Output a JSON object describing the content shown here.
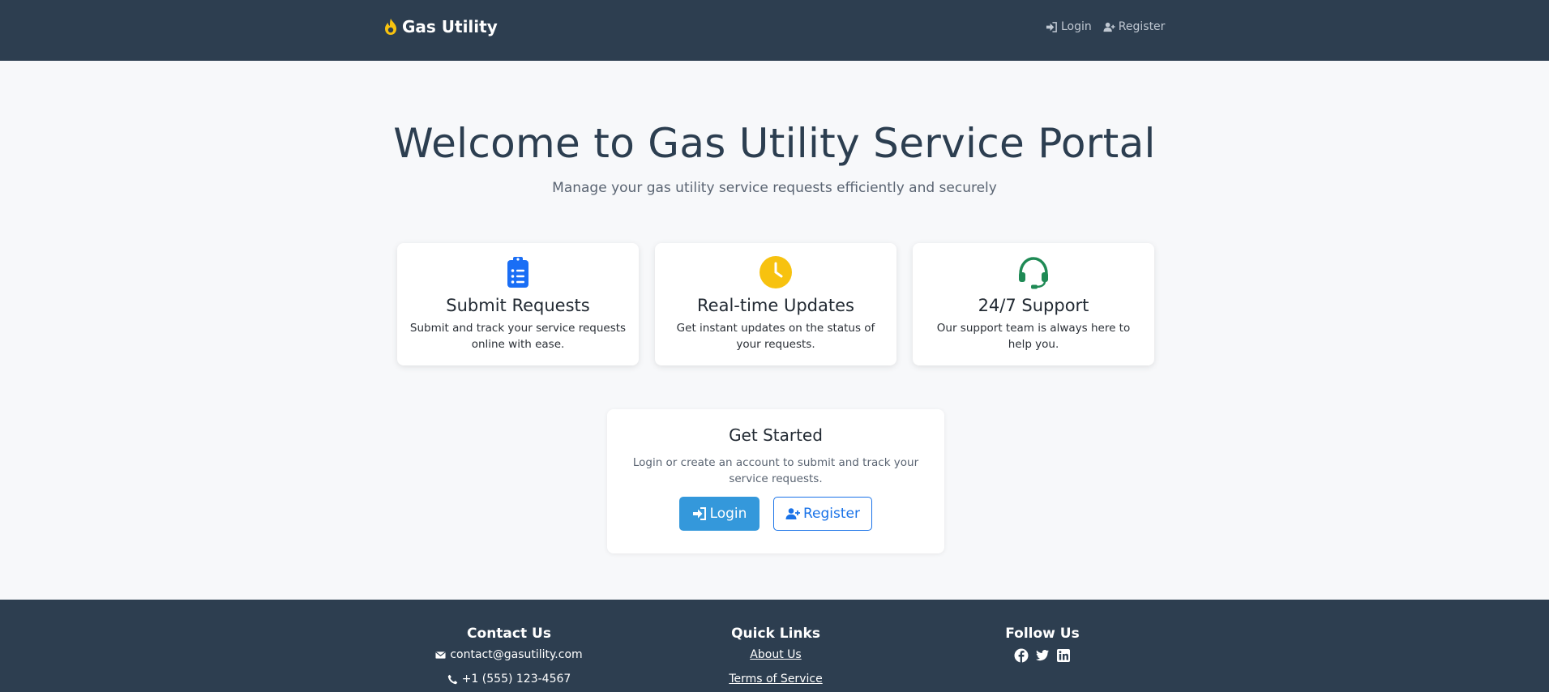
{
  "navbar": {
    "brand": "Gas Utility",
    "brand_icon": "flame-icon",
    "links": [
      {
        "label": "Login",
        "icon": "sign-in-icon"
      },
      {
        "label": "Register",
        "icon": "user-plus-icon"
      }
    ]
  },
  "hero": {
    "title": "Welcome to Gas Utility Service Portal",
    "subtitle": "Manage your gas utility service requests efficiently and securely"
  },
  "features": [
    {
      "title": "Submit Requests",
      "description": "Submit and track your service requests online with ease.",
      "icon": "clipboard-list-icon",
      "color": "#1a6ef5"
    },
    {
      "title": "Real-time Updates",
      "description": "Get instant updates on the status of your requests.",
      "icon": "clock-icon",
      "color": "#f7c20f"
    },
    {
      "title": "24/7 Support",
      "description": "Our support team is always here to help you.",
      "icon": "headset-icon",
      "color": "#1f8a55"
    }
  ],
  "get_started": {
    "title": "Get Started",
    "description": "Login or create an account to submit and track your service requests.",
    "login_label": "Login",
    "register_label": "Register"
  },
  "footer": {
    "contact": {
      "heading": "Contact Us",
      "email": "contact@gasutility.com",
      "phone": "+1 (555) 123-4567"
    },
    "quick_links": {
      "heading": "Quick Links",
      "links": [
        "About Us",
        "Terms of Service"
      ]
    },
    "follow": {
      "heading": "Follow Us",
      "icons": [
        "facebook-icon",
        "twitter-icon",
        "linkedin-icon"
      ]
    }
  },
  "colors": {
    "navbar_bg": "#2d3e50",
    "page_bg": "#f7f8fa",
    "primary_button": "#3498db",
    "outline_button": "#1a73e8",
    "brand_flame": "#f7c20f"
  }
}
